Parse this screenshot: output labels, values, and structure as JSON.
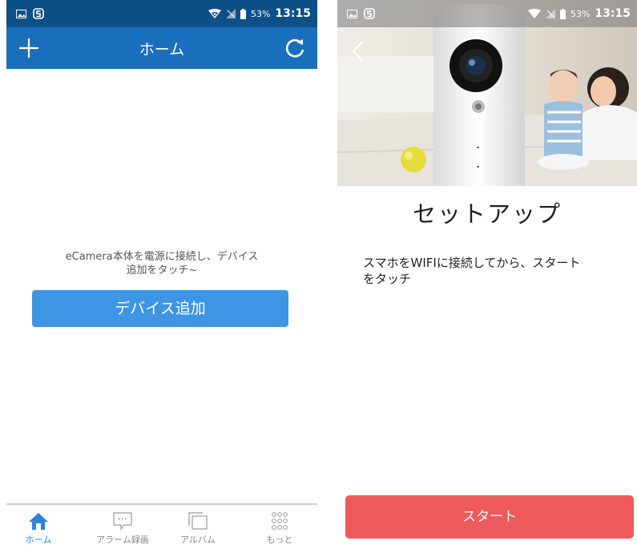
{
  "left_screen": {
    "status_bar": {
      "battery": "53%",
      "time": "13:15"
    },
    "app_bar": {
      "title": "ホーム"
    },
    "hint_text": "eCamera本体を電源に接続し、デバイス\n追加をタッチ~",
    "add_device_button": "デバイス追加",
    "tab_bar": {
      "tabs": [
        {
          "label": "ホーム",
          "icon": "home-icon",
          "active": true
        },
        {
          "label": "アラーム録画",
          "icon": "message-icon",
          "active": false
        },
        {
          "label": "アルバム",
          "icon": "album-icon",
          "active": false
        },
        {
          "label": "もっと",
          "icon": "more-grid-icon",
          "active": false
        }
      ]
    }
  },
  "right_screen": {
    "status_bar": {
      "battery": "53%",
      "time": "13:15"
    },
    "setup_title": "セットアップ",
    "setup_description": "スマホをWIFIに接続してから、スタート\nをタッチ",
    "start_button": "スタート"
  },
  "colors": {
    "status_bar": "#0d4f87",
    "app_bar": "#1a6fbd",
    "add_device_button": "#3d95e3",
    "active_tab": "#2a86d8",
    "start_button": "#ee5a5c"
  }
}
